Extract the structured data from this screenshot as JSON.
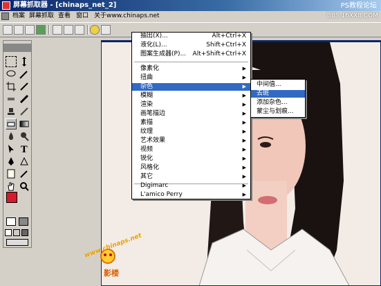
{
  "window": {
    "title": "屏幕抓取器 - [chinaps_net_2]",
    "watermark": "PS教程论坛",
    "watermark_url": "BBS.16XX8.COM"
  },
  "menubar": {
    "items": [
      "档案",
      "屏幕抓取",
      "查看",
      "窗口",
      "关于www.chinaps.net"
    ]
  },
  "filter_menu": {
    "top_partial": [
      {
        "label": "抽出(X)...",
        "shortcut": "Alt+Ctrl+X"
      },
      {
        "label": "液化(L)...",
        "shortcut": "Shift+Ctrl+X"
      },
      {
        "label": "图案生成器(P)...",
        "shortcut": "Alt+Shift+Ctrl+X"
      }
    ],
    "items": [
      {
        "label": "像素化"
      },
      {
        "label": "扭曲"
      },
      {
        "label": "杂色"
      },
      {
        "label": "模糊"
      },
      {
        "label": "渲染"
      },
      {
        "label": "画笔描边"
      },
      {
        "label": "素描"
      },
      {
        "label": "纹理"
      },
      {
        "label": "艺术效果"
      },
      {
        "label": "视频"
      },
      {
        "label": "锐化"
      },
      {
        "label": "风格化"
      },
      {
        "label": "其它"
      }
    ],
    "plugins": [
      {
        "label": "Digimarc"
      },
      {
        "label": "L'amico Perry"
      }
    ]
  },
  "noise_submenu": {
    "items": [
      {
        "label": "中间值..."
      },
      {
        "label": "去斑"
      },
      {
        "label": "添加杂色..."
      },
      {
        "label": "蒙尘与划痕..."
      }
    ]
  },
  "logo": {
    "text1": "www.chinaps.net",
    "text2": "影楼"
  }
}
